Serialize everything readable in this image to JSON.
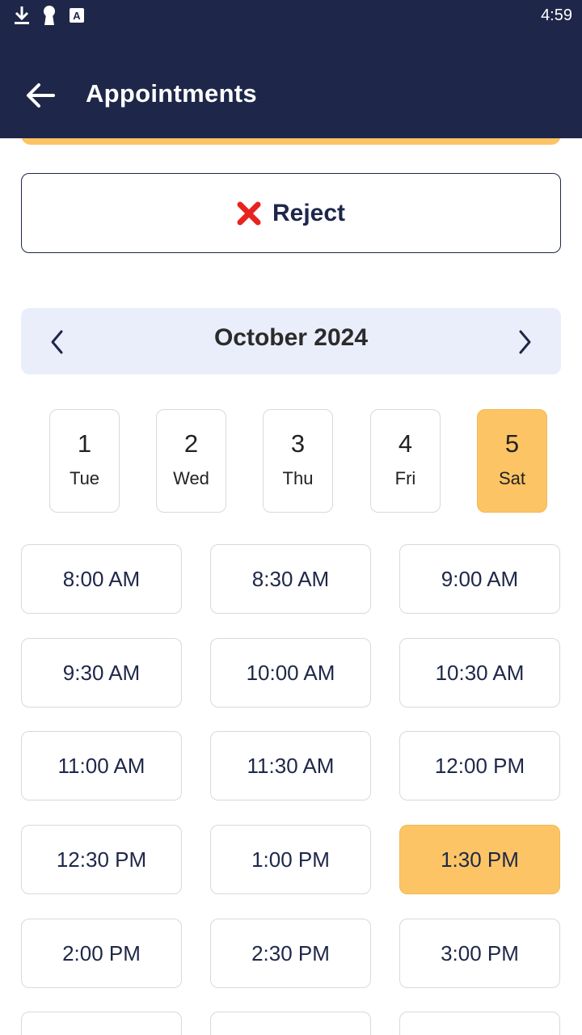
{
  "status_bar": {
    "time": "4:59",
    "icons": [
      "download-icon",
      "keyhole-icon",
      "app-a-icon"
    ]
  },
  "app_bar": {
    "title": "Appointments",
    "back_icon": "arrow-left-icon"
  },
  "actions": {
    "reject_label": "Reject",
    "reject_icon": "x-mark-icon"
  },
  "calendar": {
    "month_label": "October 2024",
    "days": [
      {
        "num": "1",
        "weekday": "Tue",
        "selected": false
      },
      {
        "num": "2",
        "weekday": "Wed",
        "selected": false
      },
      {
        "num": "3",
        "weekday": "Thu",
        "selected": false
      },
      {
        "num": "4",
        "weekday": "Fri",
        "selected": false
      },
      {
        "num": "5",
        "weekday": "Sat",
        "selected": true
      }
    ]
  },
  "time_slots": [
    {
      "label": "8:00 AM",
      "selected": false
    },
    {
      "label": "8:30 AM",
      "selected": false
    },
    {
      "label": "9:00 AM",
      "selected": false
    },
    {
      "label": "9:30 AM",
      "selected": false
    },
    {
      "label": "10:00 AM",
      "selected": false
    },
    {
      "label": "10:30 AM",
      "selected": false
    },
    {
      "label": "11:00 AM",
      "selected": false
    },
    {
      "label": "11:30 AM",
      "selected": false
    },
    {
      "label": "12:00 PM",
      "selected": false
    },
    {
      "label": "12:30 PM",
      "selected": false
    },
    {
      "label": "1:00 PM",
      "selected": false
    },
    {
      "label": "1:30 PM",
      "selected": true
    },
    {
      "label": "2:00 PM",
      "selected": false
    },
    {
      "label": "2:30 PM",
      "selected": false
    },
    {
      "label": "3:00 PM",
      "selected": false
    },
    {
      "label": "",
      "selected": false
    },
    {
      "label": "",
      "selected": false
    },
    {
      "label": "",
      "selected": false
    }
  ],
  "colors": {
    "header_bg": "#1e2749",
    "accent": "#fcc464",
    "month_bar_bg": "#eaeefa",
    "reject_icon": "#e8231f"
  }
}
